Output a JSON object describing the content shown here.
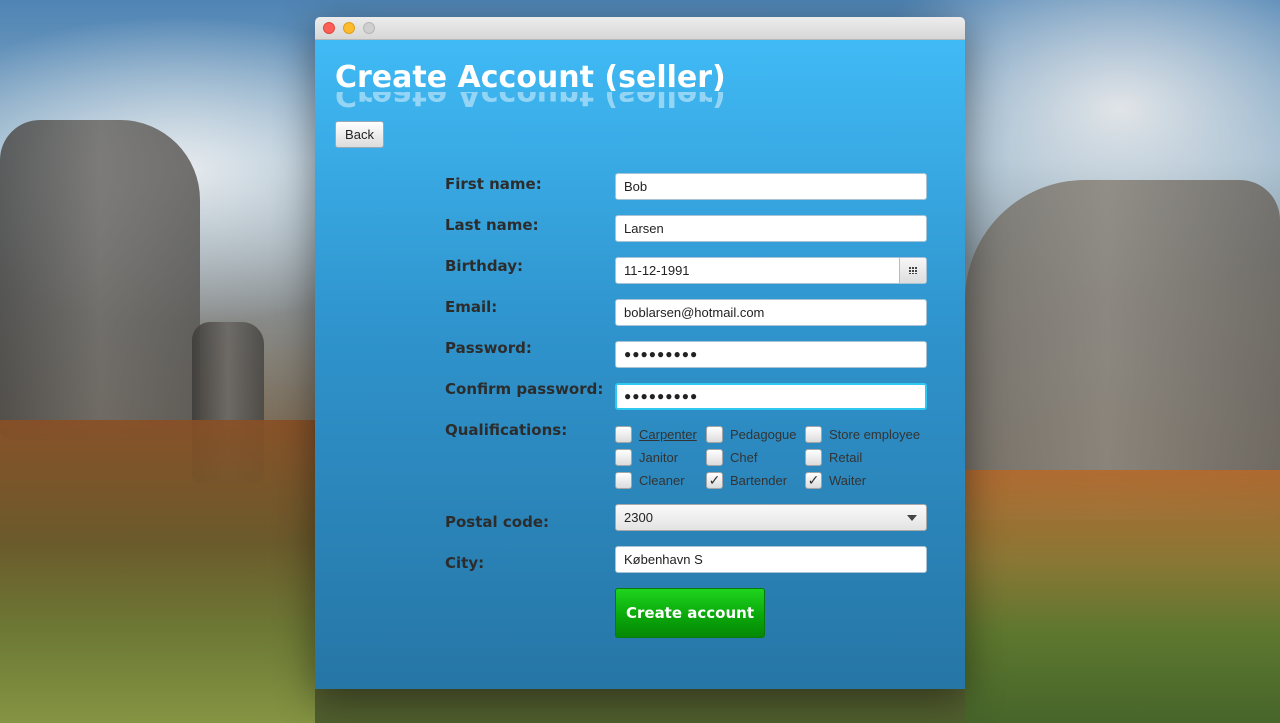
{
  "window": {
    "title": "Create Account (seller)",
    "back_label": "Back"
  },
  "form": {
    "first_name": {
      "label": "First name:",
      "value": "Bob"
    },
    "last_name": {
      "label": "Last name:",
      "value": "Larsen"
    },
    "birthday": {
      "label": "Birthday:",
      "value": "11-12-1991"
    },
    "email": {
      "label": "Email:",
      "value": "boblarsen@hotmail.com"
    },
    "password": {
      "label": "Password:",
      "value": "●●●●●●●●●"
    },
    "confirm_password": {
      "label": "Confirm password:",
      "value": "●●●●●●●●●"
    },
    "qualifications": {
      "label": "Qualifications:",
      "options": [
        {
          "label": "Carpenter",
          "checked": false
        },
        {
          "label": "Pedagogue",
          "checked": false
        },
        {
          "label": "Store employee",
          "checked": false
        },
        {
          "label": "Janitor",
          "checked": false
        },
        {
          "label": "Chef",
          "checked": false
        },
        {
          "label": "Retail",
          "checked": false
        },
        {
          "label": "Cleaner",
          "checked": false
        },
        {
          "label": "Bartender",
          "checked": true
        },
        {
          "label": "Waiter",
          "checked": true
        }
      ]
    },
    "postal_code": {
      "label": "Postal code:",
      "value": "2300"
    },
    "city": {
      "label": "City:",
      "value": "København S"
    },
    "submit_label": "Create account"
  },
  "icons": {
    "calendar": "calendar-icon",
    "dropdown": "chevron-down-icon",
    "check": "✓"
  },
  "colors": {
    "panel_top": "#40baf5",
    "panel_bottom": "#2676a6",
    "submit_green": "#0aa80a",
    "focus_ring": "#2fc8f0"
  }
}
